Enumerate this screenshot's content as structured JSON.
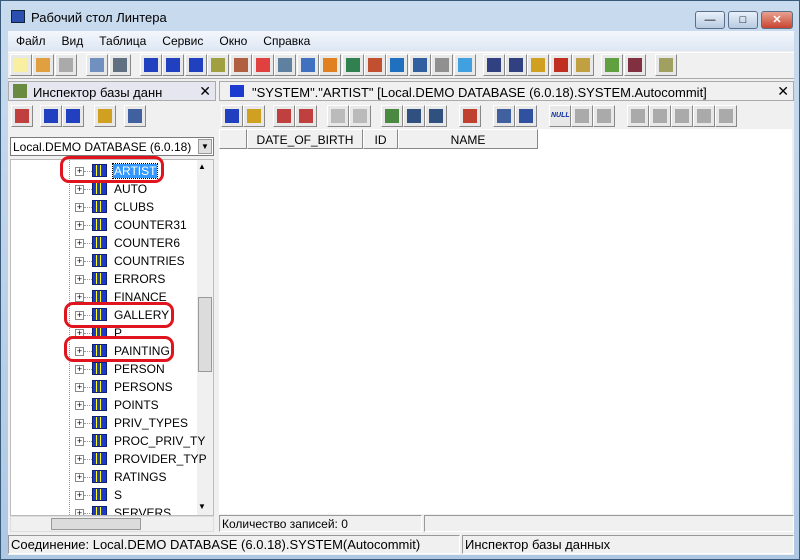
{
  "window": {
    "title": "Рабочий стол Линтера",
    "min": "—",
    "max": "□",
    "close": "✕"
  },
  "menu": [
    "Файл",
    "Вид",
    "Таблица",
    "Сервис",
    "Окно",
    "Справка"
  ],
  "main_toolbar_icons": [
    "new-document-icon",
    "open-folder-icon",
    "stop-icon",
    "connect-icon",
    "disconnect-icon",
    "table-icon",
    "table-search-icon",
    "table-import-icon",
    "bottles-icon",
    "users-icon",
    "color-icon",
    "gears-icon",
    "gear-blue-icon",
    "cross-icon",
    "people-icon",
    "database-icon",
    "network-icon",
    "monitor-icon",
    "printer-icon",
    "calendar-icon",
    "sql-icon",
    "sql-editor-icon",
    "sql-query-icon",
    "bug-icon",
    "hourglass-icon",
    "inspector-icon",
    "tools-icon",
    "edit-icon"
  ],
  "inspector": {
    "title": "Инспектор базы данн",
    "connection": "Local.DEMO DATABASE (6.0.18)",
    "tree": [
      "ARTIST",
      "AUTO",
      "CLUBS",
      "COUNTER31",
      "COUNTER6",
      "COUNTRIES",
      "ERRORS",
      "FINANCE",
      "GALLERY",
      "P",
      "PAINTING",
      "PERSON",
      "PERSONS",
      "POINTS",
      "PRIV_TYPES",
      "PROC_PRIV_TY",
      "PROVIDER_TYP",
      "RATINGS",
      "S",
      "SERVERS"
    ],
    "selected": "ARTIST",
    "highlighted": [
      "ARTIST",
      "GALLERY",
      "PAINTING"
    ]
  },
  "table_window": {
    "title": "\"SYSTEM\".\"ARTIST\" [Local.DEMO DATABASE (6.0.18).SYSTEM.Autocommit]",
    "columns": [
      "DATE_OF_BIRTH",
      "ID",
      "NAME"
    ],
    "null_label": "NULL",
    "record_count": "Количество записей: 0"
  },
  "status": {
    "connection": "Соединение: Local.DEMO DATABASE (6.0.18).SYSTEM(Autocommit)",
    "panel": "Инспектор базы данных"
  },
  "colors": {
    "highlight": "#e0141e",
    "selection": "#3399ff"
  }
}
